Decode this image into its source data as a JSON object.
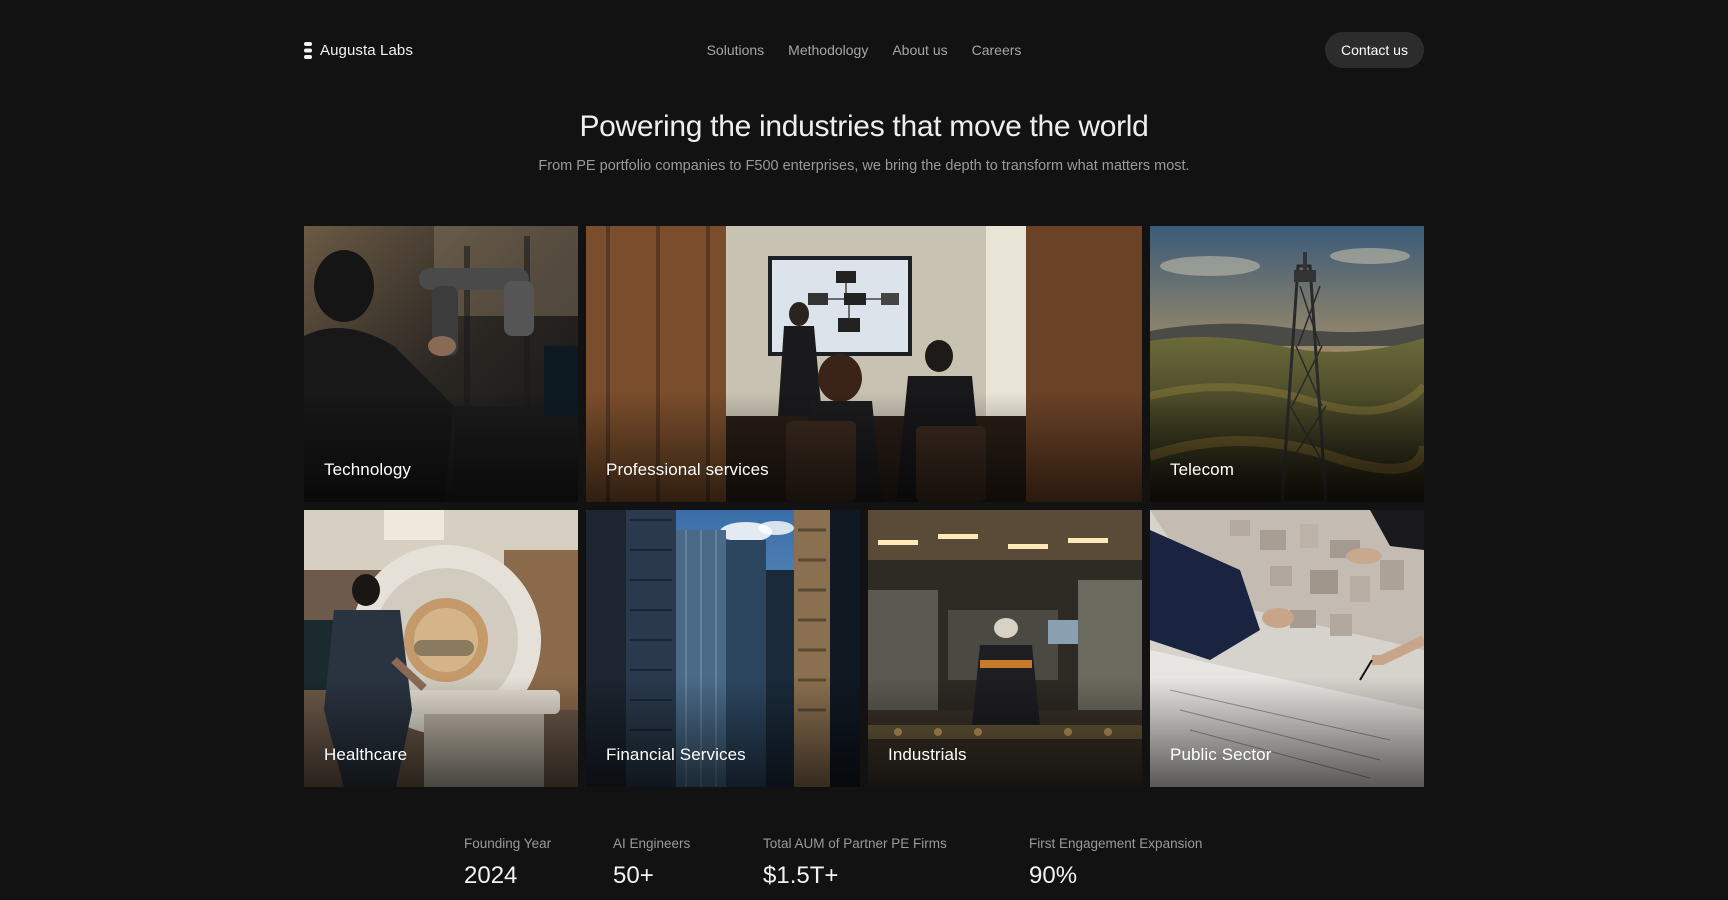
{
  "header": {
    "brand": {
      "name": "Augusta Labs",
      "icon": "stacked-dots-logo-icon"
    },
    "nav": [
      {
        "label": "Solutions"
      },
      {
        "label": "Methodology"
      },
      {
        "label": "About us"
      },
      {
        "label": "Careers"
      }
    ],
    "cta": {
      "label": "Contact us"
    }
  },
  "hero": {
    "title": "Powering the industries that move the world",
    "subtitle": "From PE portfolio companies to F500 enterprises, we bring the depth to transform what matters most."
  },
  "industries": [
    {
      "label": "Technology",
      "image": "engineer-robotic-arm-photo"
    },
    {
      "label": "Professional services",
      "image": "boardroom-presentation-photo"
    },
    {
      "label": "Telecom",
      "image": "cell-tower-sunset-landscape-photo"
    },
    {
      "label": "Healthcare",
      "image": "mri-scanner-technician-photo"
    },
    {
      "label": "Financial Services",
      "image": "glass-skyscrapers-photo"
    },
    {
      "label": "Industrials",
      "image": "factory-floor-worker-photo"
    },
    {
      "label": "Public Sector",
      "image": "urban-planning-model-photo"
    }
  ],
  "stats": [
    {
      "label": "Founding Year",
      "value": "2024"
    },
    {
      "label": "AI Engineers",
      "value": "50+"
    },
    {
      "label": "Total AUM of Partner PE Firms",
      "value": "$1.5T+"
    },
    {
      "label": "First Engagement Expansion",
      "value": "90%"
    }
  ],
  "colors": {
    "background": "#121212",
    "button": "#2c2c2c",
    "muted_text": "#9a9a9a",
    "nav_text": "#a6a6a6"
  }
}
